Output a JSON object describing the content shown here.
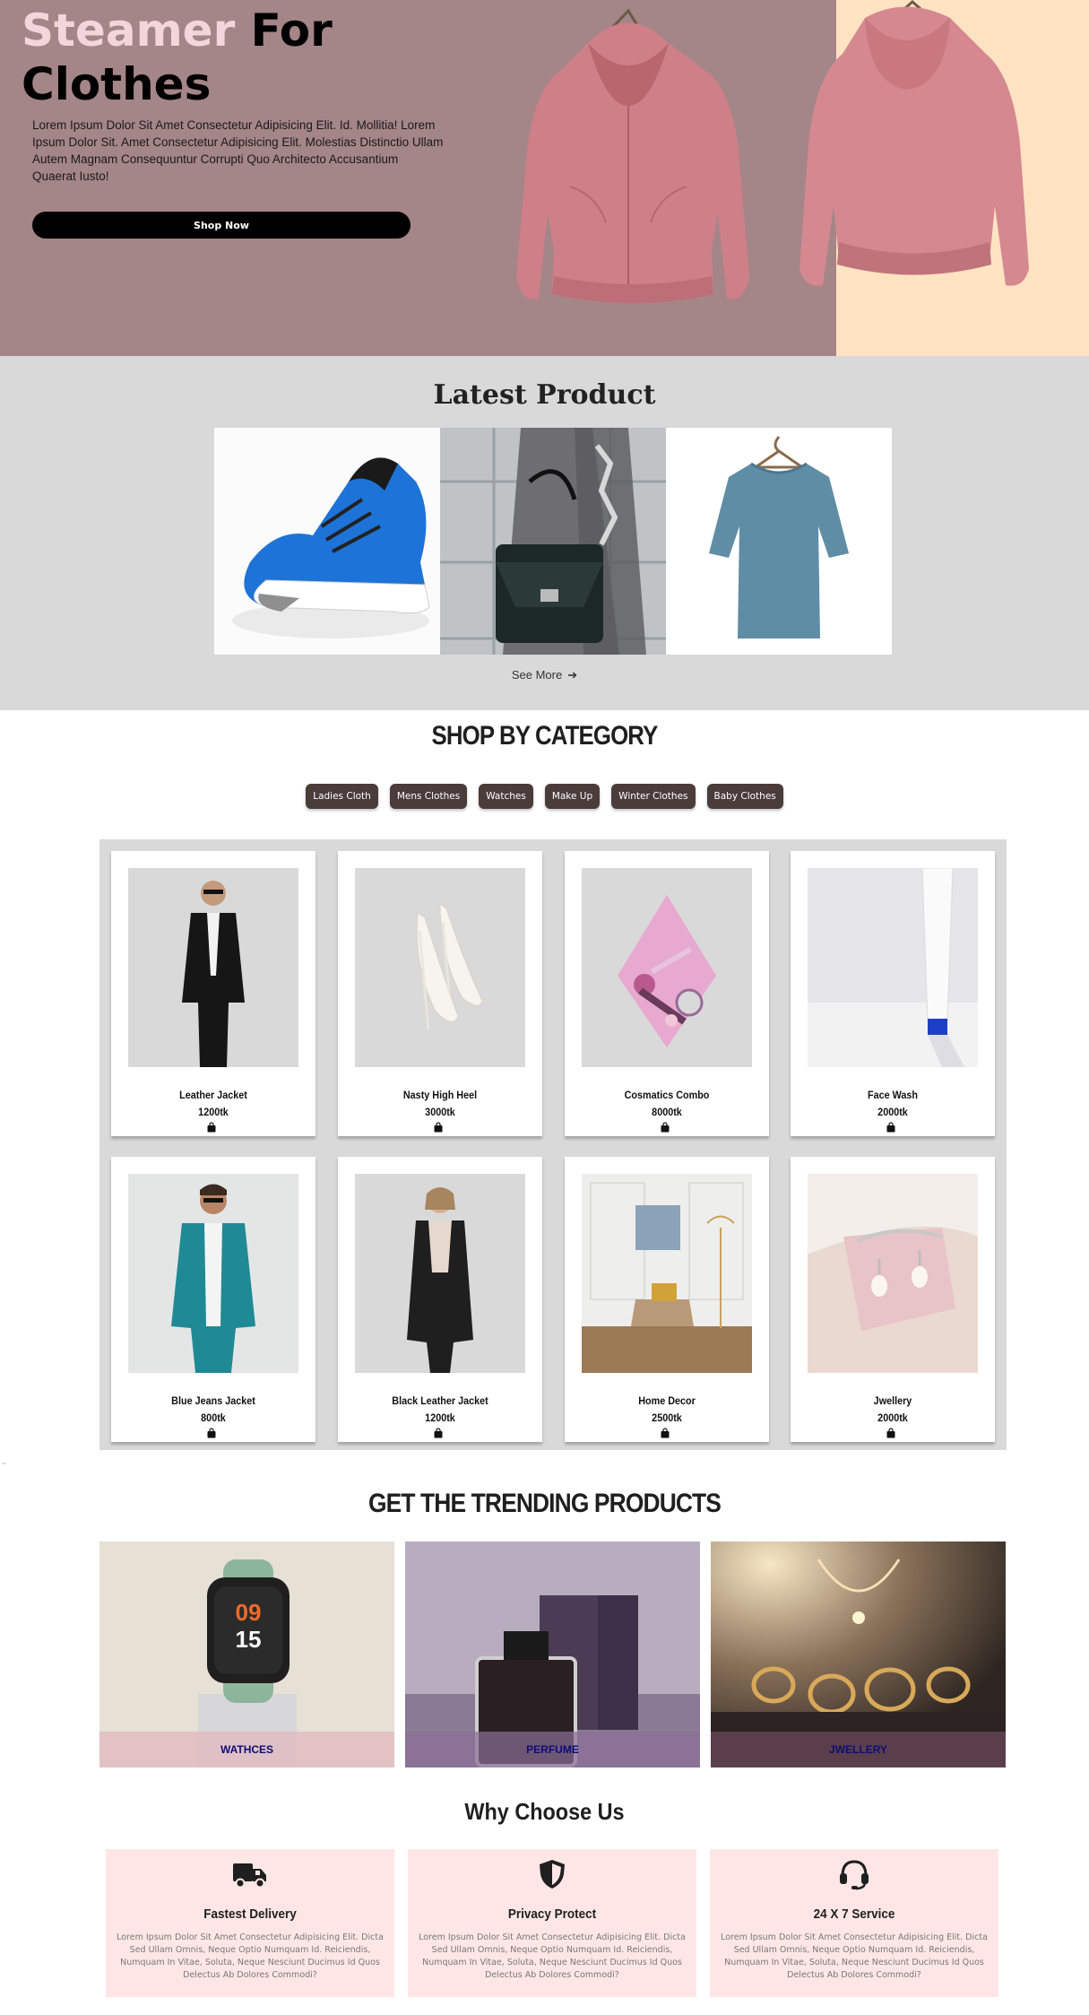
{
  "hero": {
    "title_highlight": "Steamer",
    "title_rest_line1": "For",
    "title_line2": "Clothes",
    "description": "Lorem Ipsum Dolor Sit Amet Consectetur Adipisicing Elit. Id. Mollitia! Lorem Ipsum Dolor Sit. Amet Consectetur Adipisicing Elit. Molestias Distinctio Ullam Autem Magnam Consequuntur Corrupti Quo Architecto Accusantium Quaerat Iusto!",
    "cta_label": "Shop Now"
  },
  "latest": {
    "title": "Latest Product",
    "see_more": "See More"
  },
  "category": {
    "title": "SHOP BY CATEGORY",
    "chips": [
      "Ladies Cloth",
      "Mens Clothes",
      "Watches",
      "Make Up",
      "Winter Clothes",
      "Baby Clothes"
    ],
    "products": [
      {
        "name": "Leather Jacket",
        "price": "1200tk"
      },
      {
        "name": "Nasty High Heel",
        "price": "3000tk"
      },
      {
        "name": "Cosmatics Combo",
        "price": "8000tk"
      },
      {
        "name": "Face Wash",
        "price": "2000tk"
      },
      {
        "name": "Blue Jeans Jacket",
        "price": "800tk"
      },
      {
        "name": "Black Leather Jacket",
        "price": "1200tk"
      },
      {
        "name": "Home Decor",
        "price": "2500tk"
      },
      {
        "name": "Jwellery",
        "price": "2000tk"
      }
    ]
  },
  "trending": {
    "title": "GET THE TRENDING PRODUCTS",
    "items": [
      {
        "label": "WATHCES",
        "watch_hour": "09",
        "watch_min": "15"
      },
      {
        "label": "PERFUME"
      },
      {
        "label": "JWELLERY"
      }
    ]
  },
  "why": {
    "title": "Why Choose Us",
    "cards": [
      {
        "title": "Fastest Delivery",
        "icon": "truck-icon",
        "text": "Lorem Ipsum Dolor Sit Amet Consectetur Adipisicing Elit. Dicta Sed Ullam Omnis, Neque Optio Numquam Id. Reiciendis, Numquam In Vitae, Soluta, Neque Nesciunt Ducimus Id Quos Delectus Ab Dolores Commodi?"
      },
      {
        "title": "Privacy Protect",
        "icon": "shield-icon",
        "text": "Lorem Ipsum Dolor Sit Amet Consectetur Adipisicing Elit. Dicta Sed Ullam Omnis, Neque Optio Numquam Id. Reiciendis, Numquam In Vitae, Soluta, Neque Nesciunt Ducimus Id Quos Delectus Ab Dolores Commodi?"
      },
      {
        "title": "24 X 7 Service",
        "icon": "headset-icon",
        "text": "Lorem Ipsum Dolor Sit Amet Consectetur Adipisicing Elit. Dicta Sed Ullam Omnis, Neque Optio Numquam Id. Reiciendis, Numquam In Vitae, Soluta, Neque Nesciunt Ducimus Id Quos Delectus Ab Dolores Commodi?"
      }
    ]
  },
  "colors": {
    "hero_bg": "#a48588",
    "hero_accent": "#fde3c2",
    "chip_bg": "#4a3c3a",
    "section_gray": "#d9d9d9",
    "why_card_bg": "#ffe6e6",
    "trend_label": "#0d0d7a"
  }
}
